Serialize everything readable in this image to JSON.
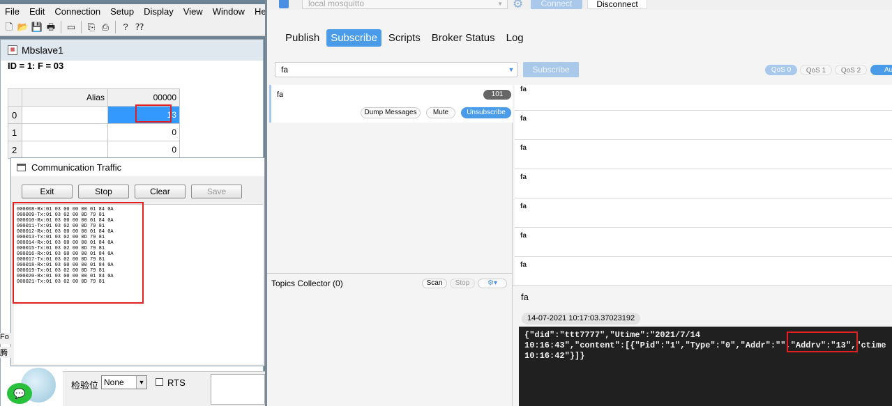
{
  "modbus": {
    "menu": [
      "File",
      "Edit",
      "Connection",
      "Setup",
      "Display",
      "View",
      "Window",
      "Hel"
    ],
    "child_title": "Mbslave1",
    "id_line": "ID = 1: F = 03",
    "grid": {
      "alias_header": "Alias",
      "address_header": "00000",
      "rows": [
        {
          "index": "0",
          "value": "13"
        },
        {
          "index": "1",
          "value": "0"
        },
        {
          "index": "2",
          "value": "0"
        }
      ]
    },
    "traffic": {
      "title": "Communication Traffic",
      "buttons": {
        "exit": "Exit",
        "stop": "Stop",
        "clear": "Clear",
        "save": "Save"
      },
      "lines": [
        "000008-Rx:01 03 00 00 00 01 84 0A",
        "000009-Tx:01 03 02 00 0D 79 81",
        "000010-Rx:01 03 00 00 00 01 84 0A",
        "000011-Tx:01 03 02 00 0D 79 81",
        "000012-Rx:01 03 00 00 00 01 84 0A",
        "000013-Tx:01 03 02 00 0D 79 81",
        "000014-Rx:01 03 00 00 00 01 84 0A",
        "000015-Tx:01 03 02 00 0D 79 81",
        "000016-Rx:01 03 00 00 00 01 84 0A",
        "000017-Tx:01 03 02 00 0D 79 81",
        "000018-Rx:01 03 00 00 00 01 84 0A",
        "000019-Tx:01 03 02 00 0D 79 81",
        "000020-Rx:01 03 00 00 00 01 84 0A",
        "000021-Tx:01 03 02 00 0D 79 81"
      ]
    },
    "status": {
      "parity_label": "检验位",
      "parity_value": "None",
      "rts_label": "RTS"
    },
    "fragments": {
      "a": "Fo",
      "b": "腾"
    }
  },
  "mqtt": {
    "profile": "local mosquitto",
    "connect": "Connect",
    "disconnect": "Disconnect",
    "tabs": [
      "Publish",
      "Subscribe",
      "Scripts",
      "Broker Status",
      "Log"
    ],
    "topic_input": "fa",
    "subscribe_button": "Subscribe",
    "qos": [
      "QoS 0",
      "QoS 1",
      "QoS 2"
    ],
    "autoscroll": "Au",
    "subscription": {
      "topic": "fa",
      "count": "101",
      "dump": "Dump Messages",
      "mute": "Mute",
      "unsubscribe": "Unsubscribe"
    },
    "collector": {
      "title": "Topics Collector (0)",
      "scan": "Scan",
      "stop": "Stop"
    },
    "messages": [
      "fa",
      "fa",
      "fa",
      "fa",
      "fa",
      "fa",
      "fa"
    ],
    "detail": {
      "topic": "fa",
      "timestamp": "14-07-2021  10:17:03.37023192",
      "payload": "{\"did\":\"ttt7777\",\"Utime\":\"2021/7/14\n10:16:43\",\"content\":[{\"Pid\":\"1\",\"Type\":\"0\",\"Addr\":\"\",\"Addrv\":\"13\",\"ctime\n10:16:42\"}]}"
    }
  },
  "colors": {
    "accent": "#4a9be8",
    "highlight_box": "#e02020",
    "selection": "#3399ff"
  }
}
